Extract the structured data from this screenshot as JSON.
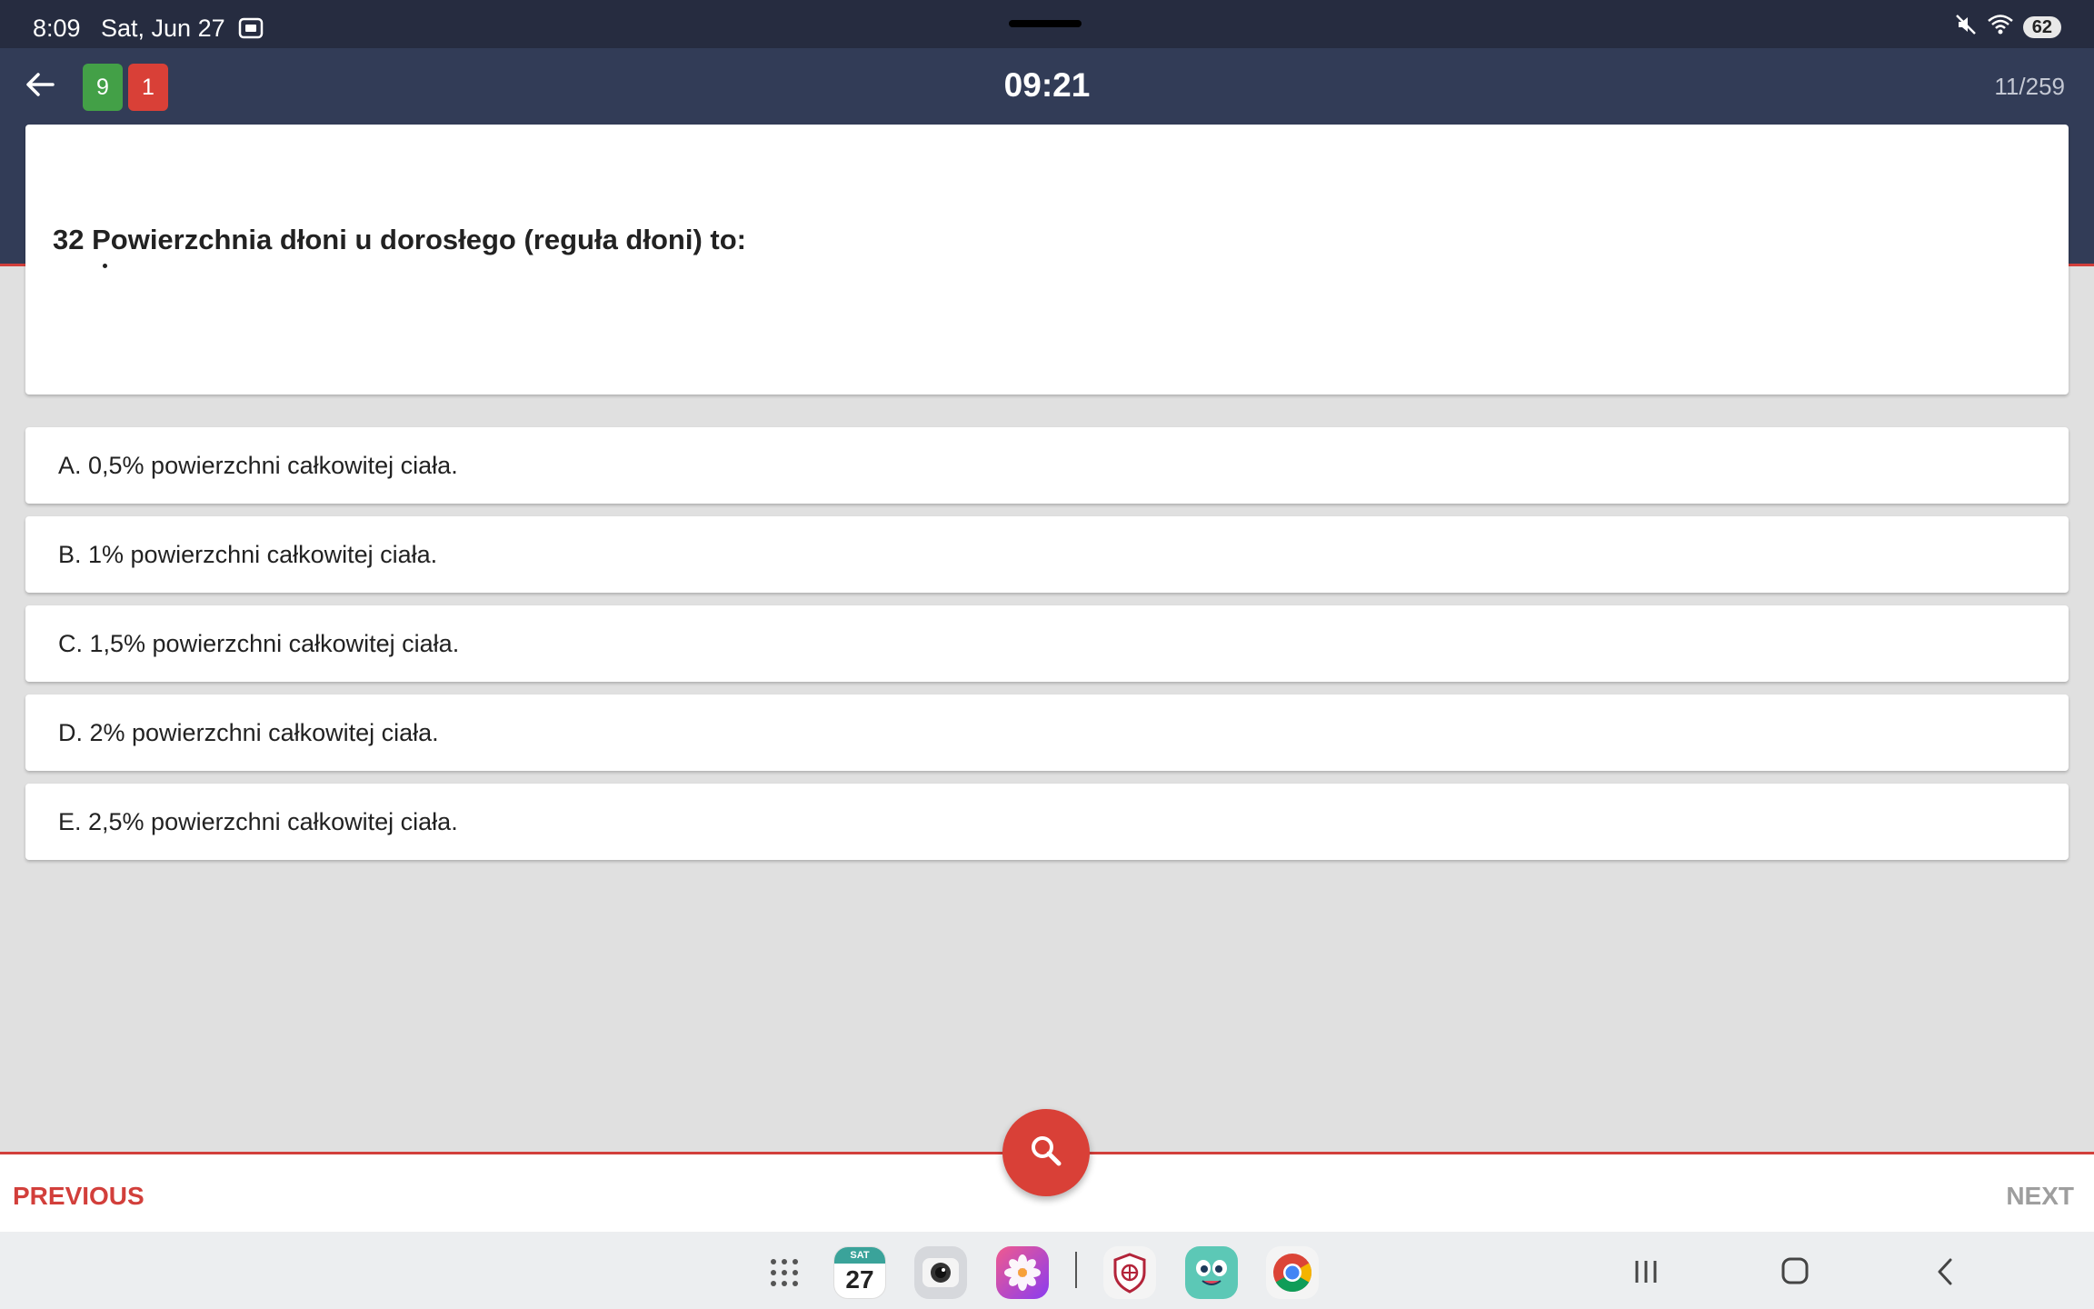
{
  "status": {
    "time": "8:09",
    "date": "Sat, Jun 27",
    "battery": "62"
  },
  "header": {
    "correct_count": "9",
    "wrong_count": "1",
    "timer": "09:21",
    "progress": "11/259"
  },
  "question": {
    "text": "32 Powierzchnia dłoni u dorosłego (reguła dłoni) to:"
  },
  "answers": [
    "A. 0,5% powierzchni całkowitej ciała.",
    "B. 1% powierzchni całkowitej ciała.",
    "C. 1,5% powierzchni całkowitej ciała.",
    "D. 2% powierzchni całkowitej ciała.",
    "E. 2,5% powierzchni całkowitej ciała."
  ],
  "nav": {
    "previous": "PREVIOUS",
    "next": "NEXT"
  },
  "taskbar": {
    "calendar_weekday": "SAT",
    "calendar_day": "27"
  },
  "colors": {
    "header_bg": "#323c57",
    "accent_red": "#d23f3b",
    "correct_green": "#43a047"
  }
}
